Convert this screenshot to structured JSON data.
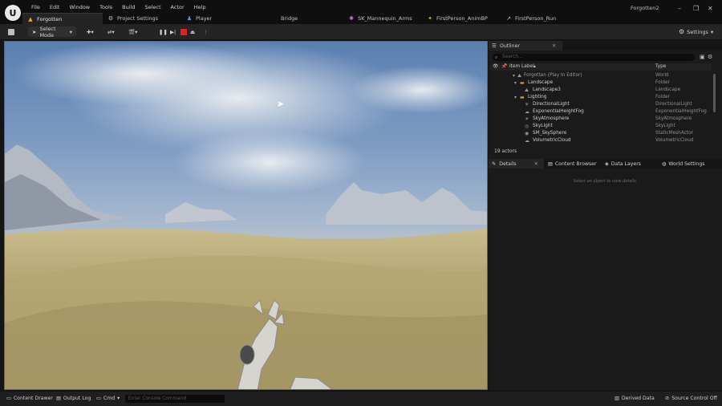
{
  "menu": [
    "File",
    "Edit",
    "Window",
    "Tools",
    "Build",
    "Select",
    "Actor",
    "Help"
  ],
  "window_title": "Forgotten2",
  "tabs": [
    {
      "label": "Forgotten",
      "icon": "level-icon",
      "color": "#e8a33b"
    },
    {
      "label": "Project Settings",
      "icon": "settings-icon",
      "color": "#cfcfcf"
    },
    {
      "label": "Player",
      "icon": "character-icon",
      "color": "#6e8de8"
    },
    {
      "label": "Bridge",
      "icon": "bridge-icon",
      "color": "#cfcfcf"
    },
    {
      "label": "SK_Mannequin_Arms",
      "icon": "skeleton-icon",
      "color": "#c07ad8"
    },
    {
      "label": "FirstPerson_AnimBP",
      "icon": "animbp-icon",
      "color": "#8fcf5a"
    },
    {
      "label": "FirstPerson_Run",
      "icon": "anim-sequence-icon",
      "color": "#9fc0e8"
    }
  ],
  "toolbar": {
    "select_mode": "Select Mode",
    "settings": "Settings"
  },
  "outliner": {
    "tab_label": "Outliner",
    "search_placeholder": "Search...",
    "col_label": "Item Label",
    "col_type": "Type",
    "rows": [
      {
        "name": "Forgotten (Play In Editor)",
        "type": "World",
        "indent": 0,
        "dim": true
      },
      {
        "name": "Landscape",
        "type": "Folder",
        "indent": 1
      },
      {
        "name": "Landscape3",
        "type": "Landscape",
        "indent": 2
      },
      {
        "name": "Lighting",
        "type": "Folder",
        "indent": 1
      },
      {
        "name": "DirectionalLight",
        "type": "DirectionalLight",
        "indent": 2
      },
      {
        "name": "ExponentialHeightFog",
        "type": "ExponentialHeightFog",
        "indent": 2
      },
      {
        "name": "SkyAtmosphere",
        "type": "SkyAtmosphere",
        "indent": 2
      },
      {
        "name": "SkyLight",
        "type": "SkyLight",
        "indent": 2
      },
      {
        "name": "SM_SkySphere",
        "type": "StaticMeshActor",
        "indent": 2
      },
      {
        "name": "VolumetricCloud",
        "type": "VolumetricCloud",
        "indent": 2
      }
    ],
    "actor_count": "19 actors"
  },
  "details": {
    "tabs": [
      "Details",
      "Content Browser",
      "Data Layers",
      "World Settings"
    ],
    "empty_message": "Select an object to view details."
  },
  "bottom": {
    "content_drawer": "Content Drawer",
    "output_log": "Output Log",
    "cmd": "Cmd",
    "console_placeholder": "Enter Console Command",
    "derived_data": "Derived Data",
    "source_control": "Source Control Off"
  }
}
